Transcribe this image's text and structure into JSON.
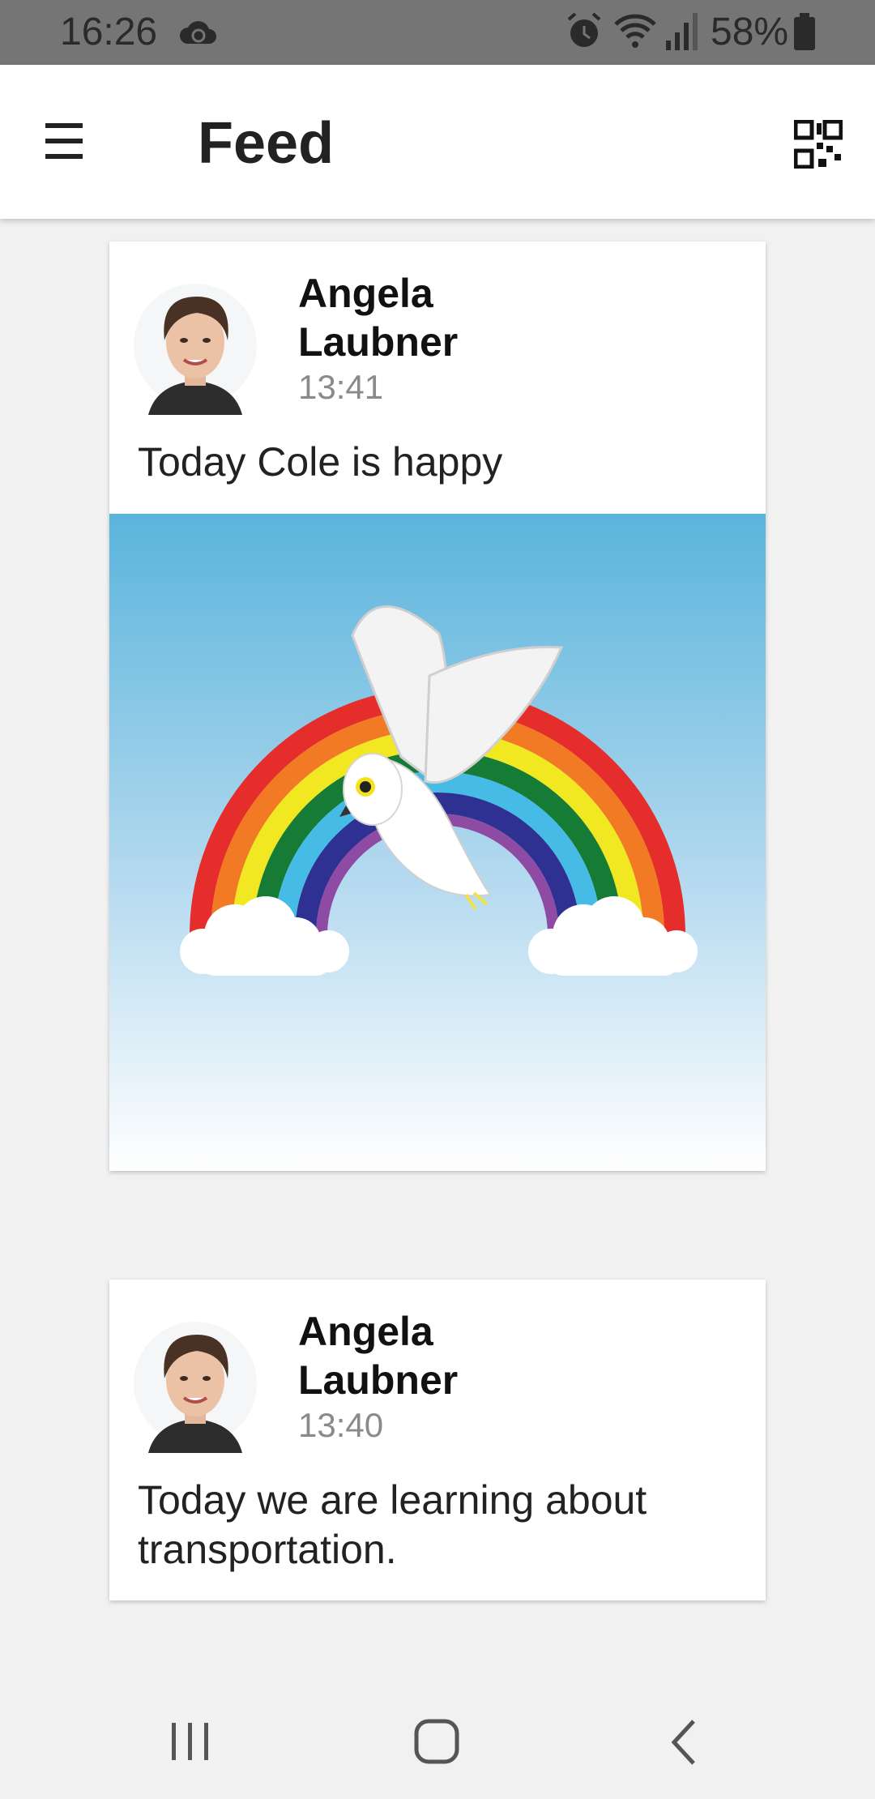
{
  "status_bar": {
    "time": "16:26",
    "battery": "58%",
    "icons": [
      "cloud-sync-icon",
      "alarm-icon",
      "wifi-icon",
      "signal-icon",
      "battery-icon"
    ]
  },
  "app_bar": {
    "title": "Feed",
    "menu_icon": "menu-icon",
    "action_icon": "qr-code-icon"
  },
  "posts": [
    {
      "author_first": "Angela",
      "author_last": "Laubner",
      "time": "13:41",
      "text": "Today Cole  is happy",
      "image": "rainbow-and-white-bird-illustration"
    },
    {
      "author_first": "Angela",
      "author_last": "Laubner",
      "time": "13:40",
      "text": "Today we are learning about transportation."
    }
  ],
  "nav_bar": {
    "icons": [
      "recent-apps-icon",
      "home-icon",
      "back-icon"
    ]
  },
  "colors": {
    "status_bar": "#757575",
    "app_bar": "#ffffff",
    "background": "#f1f1f1",
    "sky_top": "#5ab4dc",
    "sky_bottom": "#ffffff"
  }
}
